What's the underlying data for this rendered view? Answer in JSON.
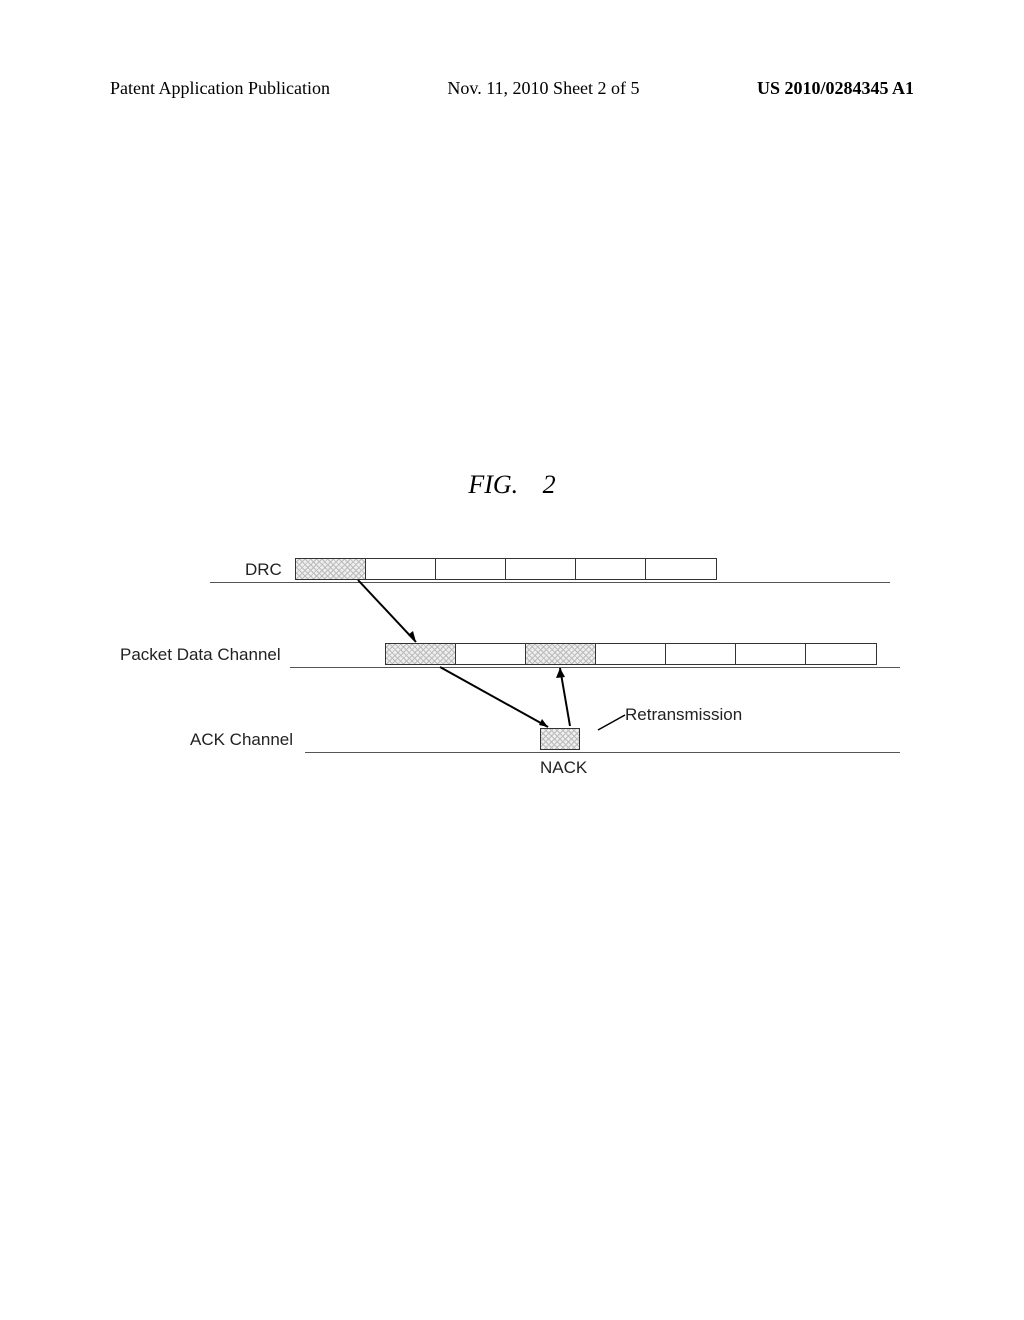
{
  "header": {
    "publication": "Patent Application Publication",
    "sheet": "Nov. 11, 2010  Sheet 2 of 5",
    "docnum": "US 2010/0284345 A1"
  },
  "figure": {
    "title_prefix": "FIG.",
    "title_number": "2"
  },
  "labels": {
    "drc": "DRC",
    "pdc": "Packet Data Channel",
    "ack": "ACK Channel",
    "nack": "NACK",
    "retrans": "Retransmission"
  }
}
